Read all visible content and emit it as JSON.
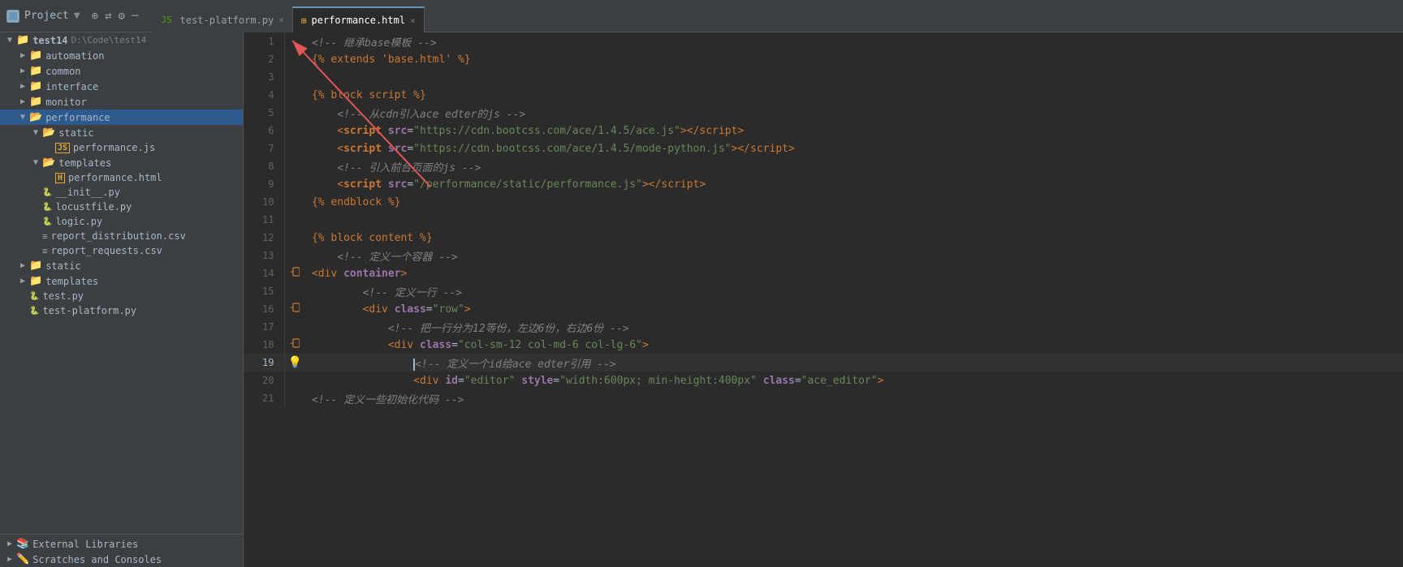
{
  "titlebar": {
    "project_label": "Project",
    "project_path": "D:\\Code\\test14",
    "project_folder": "test14"
  },
  "tabs": [
    {
      "id": "tab-py",
      "label": "test-platform.py",
      "type": "py",
      "active": false
    },
    {
      "id": "tab-html",
      "label": "performance.html",
      "type": "html",
      "active": true
    }
  ],
  "sidebar": {
    "tree": [
      {
        "id": "root",
        "label": "test14",
        "path": "D:\\Code\\test14",
        "type": "root",
        "open": true,
        "indent": 0
      },
      {
        "id": "automation",
        "label": "automation",
        "type": "folder",
        "open": false,
        "indent": 1
      },
      {
        "id": "common",
        "label": "common",
        "type": "folder",
        "open": false,
        "indent": 1
      },
      {
        "id": "interface",
        "label": "interface",
        "type": "folder",
        "open": false,
        "indent": 1
      },
      {
        "id": "monitor",
        "label": "monitor",
        "type": "folder",
        "open": false,
        "indent": 1
      },
      {
        "id": "performance",
        "label": "performance",
        "type": "folder",
        "open": true,
        "indent": 1,
        "selected": true
      },
      {
        "id": "static",
        "label": "static",
        "type": "folder",
        "open": true,
        "indent": 2
      },
      {
        "id": "perf-js",
        "label": "performance.js",
        "type": "js",
        "indent": 3
      },
      {
        "id": "templates-perf",
        "label": "templates",
        "type": "folder",
        "open": true,
        "indent": 2
      },
      {
        "id": "perf-html",
        "label": "performance.html",
        "type": "html",
        "indent": 3
      },
      {
        "id": "init-py",
        "label": "__init__.py",
        "type": "py",
        "indent": 2
      },
      {
        "id": "locustfile-py",
        "label": "locustfile.py",
        "type": "py",
        "indent": 2
      },
      {
        "id": "logic-py",
        "label": "logic.py",
        "type": "py",
        "indent": 2
      },
      {
        "id": "report-dist-csv",
        "label": "report_distribution.csv",
        "type": "csv",
        "indent": 2
      },
      {
        "id": "report-req-csv",
        "label": "report_requests.csv",
        "type": "csv",
        "indent": 2
      },
      {
        "id": "static-root",
        "label": "static",
        "type": "folder",
        "open": false,
        "indent": 1
      },
      {
        "id": "templates-root",
        "label": "templates",
        "type": "folder",
        "open": false,
        "indent": 1
      },
      {
        "id": "test-py",
        "label": "test.py",
        "type": "py",
        "indent": 1
      },
      {
        "id": "test-platform-py",
        "label": "test-platform.py",
        "type": "py",
        "indent": 1
      }
    ],
    "bottom": [
      {
        "id": "ext-libs",
        "label": "External Libraries"
      },
      {
        "id": "scratches",
        "label": "Scratches and Consoles"
      }
    ]
  },
  "editor": {
    "filename": "performance.html",
    "lines": [
      {
        "num": 1,
        "tokens": [
          {
            "t": "comment",
            "v": "<!-- 继承base模板 -->"
          }
        ]
      },
      {
        "num": 2,
        "tokens": [
          {
            "t": "jinja",
            "v": "{% extends 'base.html' %}"
          }
        ]
      },
      {
        "num": 3,
        "tokens": []
      },
      {
        "num": 4,
        "tokens": [
          {
            "t": "jinja",
            "v": "{% block script %}"
          }
        ]
      },
      {
        "num": 5,
        "tokens": [
          {
            "t": "comment",
            "v": "<!-- 从cdn引入ace edter的js -->"
          }
        ]
      },
      {
        "num": 6,
        "tokens": [
          {
            "t": "mixed",
            "parts": [
              {
                "t": "tag",
                "v": "<script "
              },
              {
                "t": "attr",
                "v": "src"
              },
              {
                "t": "normal",
                "v": "="
              },
              {
                "t": "string",
                "v": "\"https://cdn.bootcss.com/ace/1.4.5/ace.js\""
              },
              {
                "t": "tag",
                "v": "></"
              },
              {
                "t": "tag",
                "v": "script>"
              }
            ]
          }
        ]
      },
      {
        "num": 7,
        "tokens": [
          {
            "t": "mixed",
            "parts": [
              {
                "t": "tag",
                "v": "<script "
              },
              {
                "t": "attr",
                "v": "src"
              },
              {
                "t": "normal",
                "v": "="
              },
              {
                "t": "string",
                "v": "\"https://cdn.bootcss.com/ace/1.4.5/mode-python.js\""
              },
              {
                "t": "tag",
                "v": "></"
              },
              {
                "t": "tag",
                "v": "script>"
              }
            ]
          }
        ]
      },
      {
        "num": 8,
        "tokens": [
          {
            "t": "comment",
            "v": "<!-- 引入前台页面的js -->"
          }
        ]
      },
      {
        "num": 9,
        "tokens": [
          {
            "t": "mixed",
            "parts": [
              {
                "t": "tag",
                "v": "<script "
              },
              {
                "t": "attr",
                "v": "src"
              },
              {
                "t": "normal",
                "v": "="
              },
              {
                "t": "string",
                "v": "\"/performance/static/performance.js\""
              },
              {
                "t": "tag",
                "v": "></"
              },
              {
                "t": "tag",
                "v": "script>"
              }
            ]
          }
        ]
      },
      {
        "num": 10,
        "tokens": [
          {
            "t": "jinja",
            "v": "{% endblock %}"
          }
        ]
      },
      {
        "num": 11,
        "tokens": []
      },
      {
        "num": 12,
        "tokens": [
          {
            "t": "jinja",
            "v": "{% block content %}"
          }
        ]
      },
      {
        "num": 13,
        "tokens": [
          {
            "t": "comment",
            "v": "<!-- 定义一个容器 -->"
          }
        ]
      },
      {
        "num": 14,
        "tokens": [
          {
            "t": "mixed",
            "parts": [
              {
                "t": "tag",
                "v": "<div "
              },
              {
                "t": "attr",
                "v": "container"
              },
              {
                "t": "tag",
                "v": ">"
              }
            ]
          }
        ]
      },
      {
        "num": 15,
        "tokens": [
          {
            "t": "comment",
            "v": "<!-- 定义一行 -->"
          }
        ]
      },
      {
        "num": 16,
        "tokens": [
          {
            "t": "mixed",
            "parts": [
              {
                "t": "tag",
                "v": "<div "
              },
              {
                "t": "attr",
                "v": "class"
              },
              {
                "t": "normal",
                "v": "="
              },
              {
                "t": "string",
                "v": "\"row\""
              },
              {
                "t": "tag",
                "v": ">"
              }
            ]
          }
        ]
      },
      {
        "num": 17,
        "tokens": [
          {
            "t": "comment",
            "v": "<!-- 把一行分为12等份，左边6份，右边6份 -->"
          }
        ]
      },
      {
        "num": 18,
        "tokens": [
          {
            "t": "mixed",
            "parts": [
              {
                "t": "tag",
                "v": "<div "
              },
              {
                "t": "attr",
                "v": "class"
              },
              {
                "t": "normal",
                "v": "="
              },
              {
                "t": "string",
                "v": "\"col-sm-12 col-md-6 col-lg-6\""
              },
              {
                "t": "tag",
                "v": ">"
              }
            ]
          }
        ]
      },
      {
        "num": 19,
        "tokens": [
          {
            "t": "comment",
            "v": "<!-- 定义一个id给ace edter引用 -->"
          }
        ],
        "gutter": "bulb",
        "active": true
      },
      {
        "num": 20,
        "tokens": [
          {
            "t": "mixed",
            "parts": [
              {
                "t": "tag",
                "v": "<div "
              },
              {
                "t": "attr",
                "v": "id"
              },
              {
                "t": "normal",
                "v": "="
              },
              {
                "t": "string",
                "v": "\"editor\""
              },
              {
                "t": "normal",
                "v": " "
              },
              {
                "t": "attr",
                "v": "style"
              },
              {
                "t": "normal",
                "v": "="
              },
              {
                "t": "string",
                "v": "\"width:600px; min-height:400px\""
              },
              {
                "t": "normal",
                "v": " "
              },
              {
                "t": "attr",
                "v": "class"
              },
              {
                "t": "normal",
                "v": "="
              },
              {
                "t": "string",
                "v": "\"ace_editor\""
              },
              {
                "t": "tag",
                "v": ">"
              }
            ]
          }
        ]
      },
      {
        "num": 21,
        "tokens": [
          {
            "t": "comment",
            "v": "<!-- 定义一些初始化代码 -->"
          }
        ]
      }
    ]
  },
  "colors": {
    "bg": "#2b2b2b",
    "sidebar_bg": "#3c3f41",
    "accent": "#6897bb",
    "active_tab_border": "#6897bb",
    "selected_item": "#2d5a8e",
    "comment": "#808080",
    "jinja": "#cc7832",
    "tag": "#cc7832",
    "attr": "#9876aa",
    "string": "#6a8759",
    "normal": "#a9b7c6"
  }
}
